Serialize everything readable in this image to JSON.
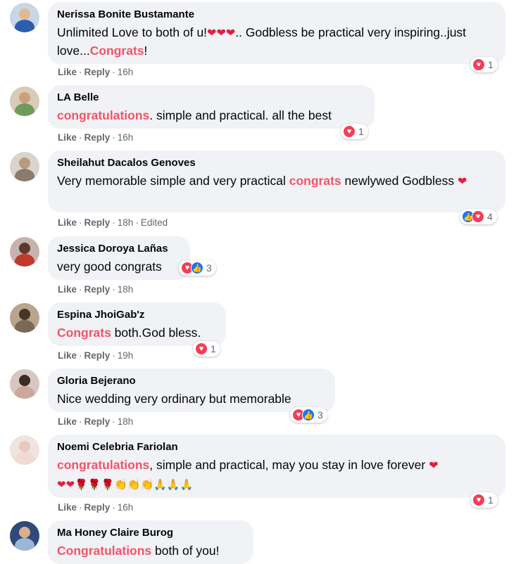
{
  "actions": {
    "like": "Like",
    "reply": "Reply",
    "sep": "·"
  },
  "colors": {
    "highlight": "#f35369",
    "heart": "#e41e3f",
    "like_blue": "#1877f2",
    "love_red": "#f33e58",
    "bubble_bg": "#f0f2f5"
  },
  "comments": [
    {
      "name": "Nerissa Bonite Bustamante",
      "text_a": "Unlimited Love to both of u!",
      "emoji_a": "❤❤❤",
      "text_b": ".. Godbless be practical very inspiring..just love...",
      "highlight": "Congrats",
      "text_c": "!",
      "time": "16h",
      "reaction_icons": [
        "love"
      ],
      "reaction_count": "1"
    },
    {
      "name": "LA Belle",
      "highlight": "congratulations",
      "text_b": ". simple and practical. all the best",
      "time": "16h",
      "reaction_icons": [
        "love"
      ],
      "reaction_count": "1"
    },
    {
      "name": "Sheilahut Dacalos Genoves",
      "text_a": "Very memorable simple and very practical ",
      "highlight": "congrats",
      "text_b": " newlywed Godbless ",
      "emoji_b": "❤",
      "time": "18h",
      "edited": "Edited",
      "reaction_icons": [
        "like",
        "love"
      ],
      "reaction_count": "4"
    },
    {
      "name": "Jessica Doroya Lañas",
      "text_a": "very good congrats",
      "time": "18h",
      "reaction_icons": [
        "love",
        "like"
      ],
      "reaction_count": "3"
    },
    {
      "name": "Espina JhoiGab'z",
      "highlight": "Congrats",
      "text_b": " both.God bless.",
      "time": "19h",
      "reaction_icons": [
        "love"
      ],
      "reaction_count": "1"
    },
    {
      "name": "Gloria Bejerano",
      "text_a": "Nice wedding very ordinary but memorable",
      "time": "18h",
      "reaction_icons": [
        "love",
        "like"
      ],
      "reaction_count": "3"
    },
    {
      "name": "Noemi Celebria Fariolan",
      "highlight": "congratulations",
      "text_b": ", simple and practical, may you stay in love forever ",
      "emoji_b": "❤",
      "emoji_line": "❤❤🌹🌹🌹👏👏👏🙏🙏🙏",
      "time": "16h",
      "reaction_icons": [
        "love"
      ],
      "reaction_count": "1"
    },
    {
      "name": "Ma Honey Claire Burog",
      "highlight": "Congratulations",
      "text_b": " both of you!"
    }
  ]
}
